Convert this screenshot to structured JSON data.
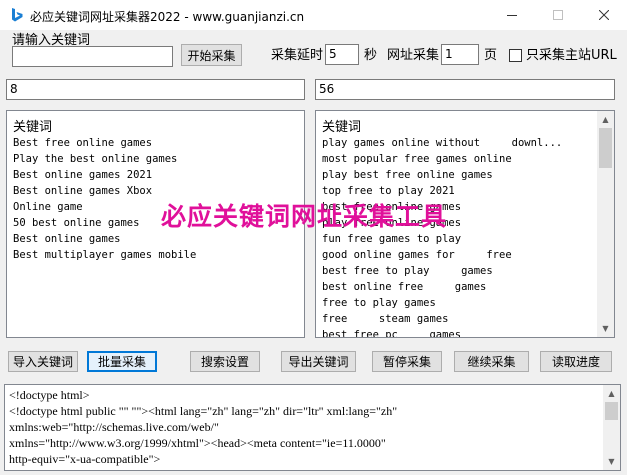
{
  "window": {
    "title": "必应关键词网址采集器2022 - www.guanjianzi.cn",
    "icon": "bing-icon"
  },
  "controls": {
    "keyword_prompt": "请输入关键词",
    "keyword_input_value": "",
    "start_button": "开始采集",
    "delay_label": "采集延时",
    "delay_value": "5",
    "delay_unit": "秒",
    "pages_label": "网址采集",
    "pages_value": "1",
    "pages_unit": "页",
    "main_site_only_label": "只采集主站URL",
    "main_site_only_checked": false
  },
  "counts": {
    "left_count": "8",
    "right_count": "56"
  },
  "left_list": {
    "header": "关键词",
    "items": [
      "Best free online games",
      "Play the best online games",
      "Best online games 2021",
      "Best online games Xbox",
      "Online game",
      "50 best online games",
      "Best online games",
      "Best multiplayer games mobile"
    ]
  },
  "right_list": {
    "header": "关键词",
    "items": [
      "play games online without     downl...",
      "most popular free games online",
      "play best free online games",
      "top free to play 2021",
      "best free online games",
      "play free online games",
      "fun free games to play",
      "good online games for     free",
      "best free to play     games",
      "best online free     games",
      "free to play games",
      "free     steam games",
      "best free pc     games"
    ]
  },
  "buttons": {
    "import": "导入关键词",
    "batch": "批量采集",
    "search_settings": "搜索设置",
    "export": "导出关键词",
    "pause": "暂停采集",
    "resume": "继续采集",
    "read_progress": "读取进度"
  },
  "output": {
    "lines": [
      "<!doctype html>",
      "<!doctype html public \"\" \"\"><html lang=\"zh\" lang=\"zh\" dir=\"ltr\" xml:lang=\"zh\"",
      "xmlns:web=\"http://schemas.live.com/web/\"",
      "xmlns=\"http://www.w3.org/1999/xhtml\"><head><meta content=\"ie=11.0000\"",
      "http-equiv=\"x-ua-compatible\">"
    ]
  },
  "watermark": "必应关键词网址采集工具",
  "colors": {
    "watermark": "#e0109a",
    "bing_icon": "#1a7fd4",
    "active_border": "#0078d7"
  }
}
